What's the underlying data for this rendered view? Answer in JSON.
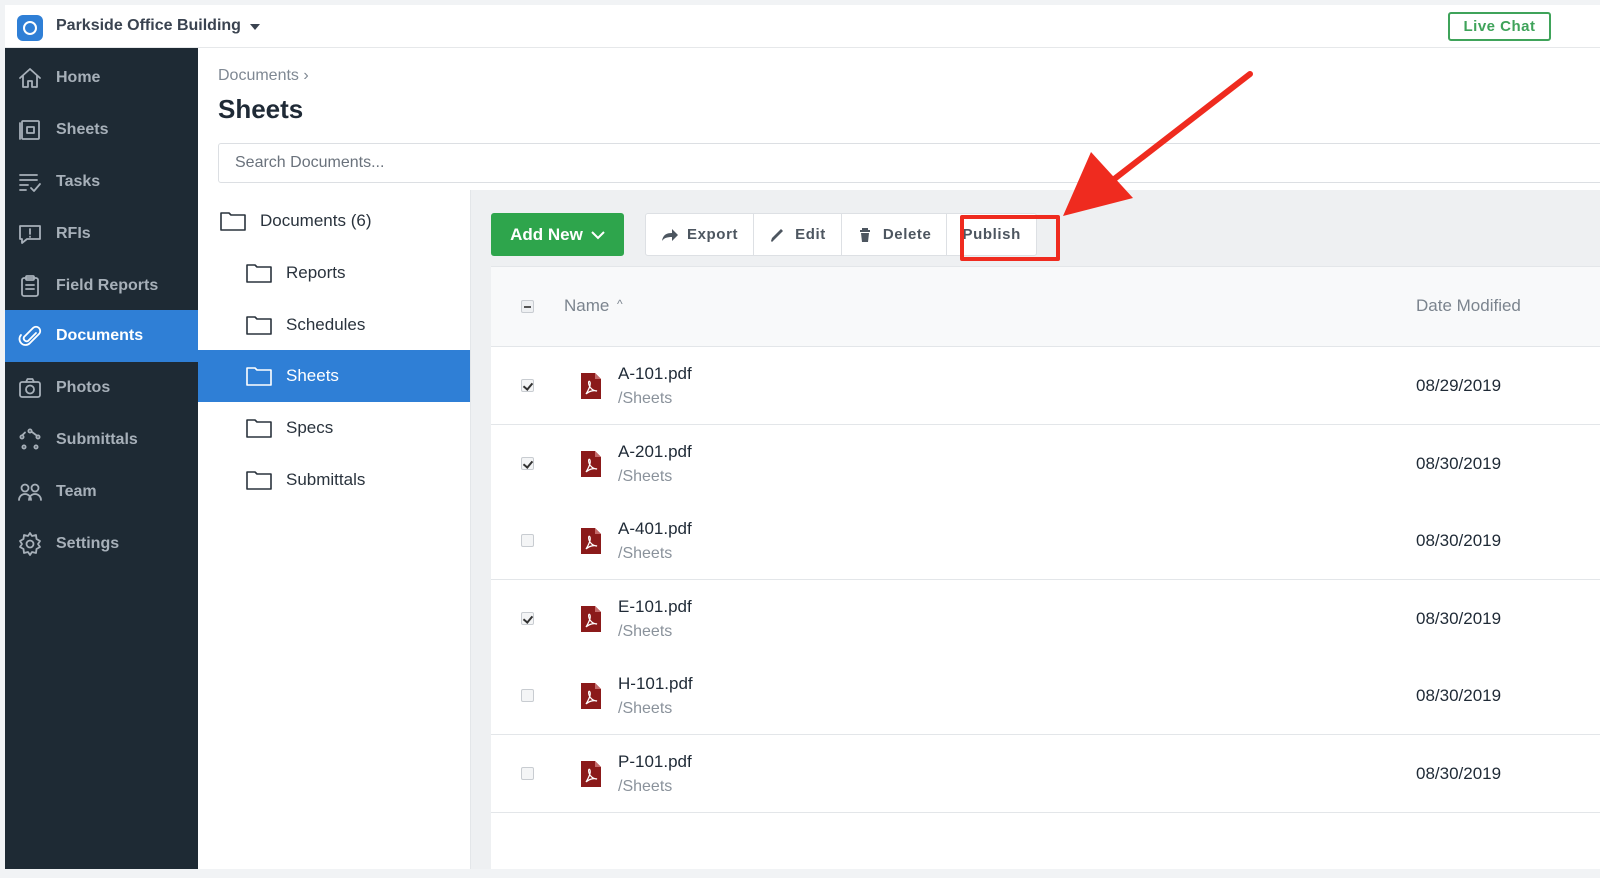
{
  "project": {
    "name": "Parkside Office Building",
    "live_chat_label": "Live Chat"
  },
  "sidebar": {
    "items": [
      {
        "label": "Home",
        "icon": "home-icon"
      },
      {
        "label": "Sheets",
        "icon": "sheets-icon"
      },
      {
        "label": "Tasks",
        "icon": "tasks-icon"
      },
      {
        "label": "RFIs",
        "icon": "rfis-icon"
      },
      {
        "label": "Field Reports",
        "icon": "clipboard-icon"
      },
      {
        "label": "Documents",
        "icon": "paperclip-icon",
        "active": true
      },
      {
        "label": "Photos",
        "icon": "camera-icon"
      },
      {
        "label": "Submittals",
        "icon": "submittals-icon"
      },
      {
        "label": "Team",
        "icon": "team-icon"
      },
      {
        "label": "Settings",
        "icon": "gear-icon"
      }
    ]
  },
  "header": {
    "breadcrumb": "Documents ›",
    "title": "Sheets"
  },
  "search": {
    "placeholder": "Search Documents..."
  },
  "tree": {
    "root": "Documents (6)",
    "folders": [
      "Reports",
      "Schedules",
      "Sheets",
      "Specs",
      "Submittals"
    ],
    "active": "Sheets"
  },
  "toolbar": {
    "add_new": "Add New",
    "export": "Export",
    "edit": "Edit",
    "delete": "Delete",
    "publish": "Publish"
  },
  "table": {
    "columns": {
      "name": "Name",
      "name_sort": "^",
      "date": "Date Modified"
    },
    "rows": [
      {
        "name": "A-101.pdf",
        "path": "/Sheets",
        "date": "08/29/2019",
        "checked": true
      },
      {
        "name": "A-201.pdf",
        "path": "/Sheets",
        "date": "08/30/2019",
        "checked": true
      },
      {
        "name": "A-401.pdf",
        "path": "/Sheets",
        "date": "08/30/2019",
        "checked": false
      },
      {
        "name": "E-101.pdf",
        "path": "/Sheets",
        "date": "08/30/2019",
        "checked": true
      },
      {
        "name": "H-101.pdf",
        "path": "/Sheets",
        "date": "08/30/2019",
        "checked": false
      },
      {
        "name": "P-101.pdf",
        "path": "/Sheets",
        "date": "08/30/2019",
        "checked": false
      }
    ]
  },
  "colors": {
    "accent": "#2f7fd6",
    "success": "#2ea54c",
    "sidebar_bg": "#1e2a34",
    "annotation": "#ef2b1f",
    "pdf": "#8b1a1a"
  }
}
